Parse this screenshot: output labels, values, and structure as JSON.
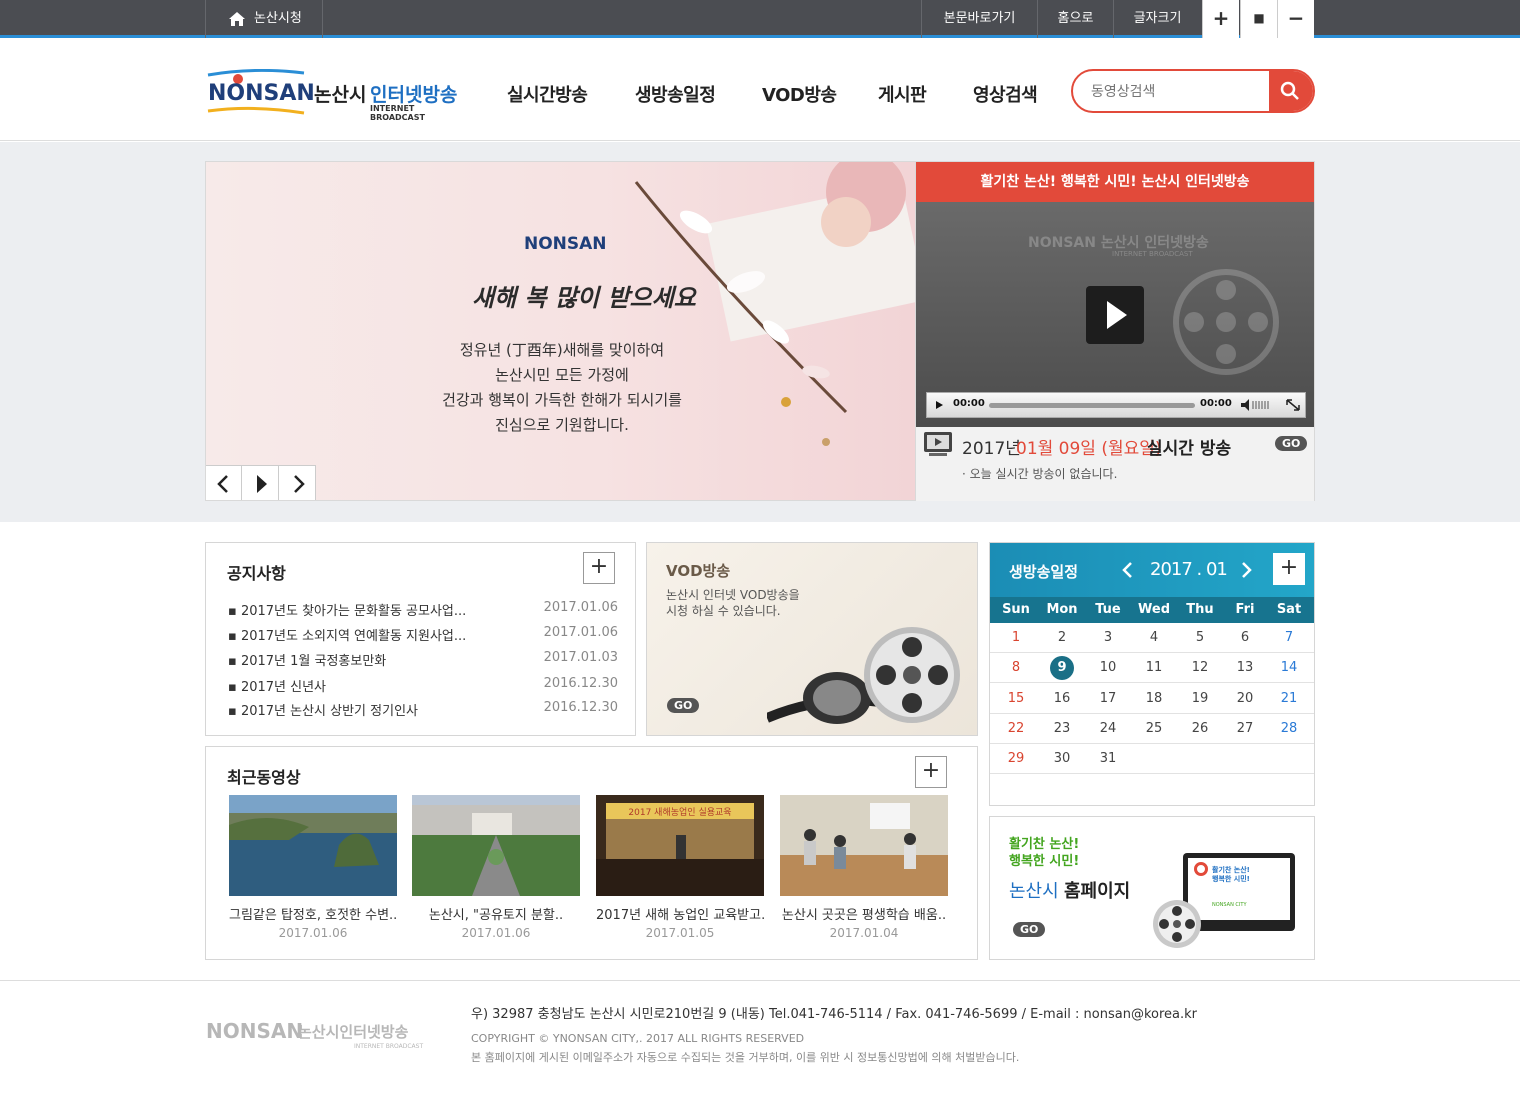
{
  "topbar": {
    "home_label": "논산시청",
    "skip_label": "본문바로가기",
    "home2_label": "홈으로",
    "fontsize_label": "글자크기",
    "fs_plus": "+",
    "fs_reset": "■",
    "fs_minus": "−"
  },
  "header": {
    "logo_en": "NONSAN",
    "logo_ko_a": "논산시",
    "logo_ko_b": "인터넷방송",
    "logo_sub": "INTERNET BROADCAST",
    "nav": [
      "실시간방송",
      "생방송일정",
      "VOD방송",
      "게시판",
      "영상검색"
    ],
    "search_placeholder": "동영상검색"
  },
  "hero": {
    "slide_logo": "NONSAN",
    "slide_heading": "새해 복 많이 받으세요",
    "slide_lines": [
      "정유년 (丁酉年)새해를 맞이하여",
      "논산시민 모든 가정에",
      "건강과 행복이 가득한 한해가 되시기를",
      "진심으로 기원합니다."
    ],
    "player_banner": "활기찬 논산! 행복한 시민! 논산시 인터넷방송",
    "player_watermark": "NONSAN 논산시 인터넷방송",
    "player_watermark_sub": "INTERNET BROADCAST",
    "time_current": "00:00",
    "time_total": "00:00",
    "live_year": "2017년",
    "live_date": "01월 09일 (월요일)",
    "live_title": "실시간 방송",
    "live_go": "GO",
    "live_note": "오늘 실시간 방송이 없습니다."
  },
  "notice": {
    "title": "공지사항",
    "items": [
      {
        "title": "2017년도 찾아가는 문화활동 공모사업...",
        "date": "2017.01.06"
      },
      {
        "title": "2017년도 소외지역 연예활동 지원사업...",
        "date": "2017.01.06"
      },
      {
        "title": "2017년 1월 국정홍보만화",
        "date": "2017.01.03"
      },
      {
        "title": " 2017년 신년사",
        "date": "2016.12.30"
      },
      {
        "title": "2017년 논산시 상반기 정기인사",
        "date": "2016.12.30"
      }
    ]
  },
  "vod": {
    "title": "VOD방송",
    "desc1": "논산시 인터넷 VOD방송을",
    "desc2": "시청 하실 수 있습니다.",
    "go": "GO"
  },
  "recent": {
    "title": "최근동영상",
    "items": [
      {
        "title": "그림같은 탑정호, 호젓한 수변..",
        "date": "2017.01.06"
      },
      {
        "title": "논산시, \"공유토지 분할..",
        "date": "2017.01.06"
      },
      {
        "title": "2017년 새해 농업인 교육받고..",
        "date": "2017.01.05"
      },
      {
        "title": "논산시 곳곳은 평생학습 배움..",
        "date": "2017.01.04"
      }
    ]
  },
  "calendar": {
    "title": "생방송일정",
    "month": "2017 . 01",
    "days": [
      "Sun",
      "Mon",
      "Tue",
      "Wed",
      "Thu",
      "Fri",
      "Sat"
    ],
    "weeks": [
      [
        "1",
        "2",
        "3",
        "4",
        "5",
        "6",
        "7"
      ],
      [
        "8",
        "9",
        "10",
        "11",
        "12",
        "13",
        "14"
      ],
      [
        "15",
        "16",
        "17",
        "18",
        "19",
        "20",
        "21"
      ],
      [
        "22",
        "23",
        "24",
        "25",
        "26",
        "27",
        "28"
      ],
      [
        "29",
        "30",
        "31",
        "",
        "",
        "",
        ""
      ]
    ],
    "today": "9",
    "colors": {
      "header": "#1e8fb5",
      "days_bar": "#17748f",
      "sun": "#d9442f",
      "sat": "#2a7ad6",
      "today": "#1a6f86"
    }
  },
  "homepage": {
    "line1": "활기찬 논산!",
    "line2": "행복한 시민!",
    "line3_a": "논산시",
    "line3_b": "홈페이지",
    "go": "GO",
    "monitor_text1": "활기찬 논산!",
    "monitor_text2": "행복한 시민!",
    "monitor_brand": "NONSAN CITY"
  },
  "footer": {
    "logo_en": "NONSAN",
    "logo_ko": "논산시인터넷방송",
    "logo_sub": "INTERNET BROADCAST",
    "address": "우) 32987 충청남도 논산시 시민로210번길 9 (내동) Tel.041-746-5114 / Fax. 041-746-5699 / E-mail : nonsan@korea.kr",
    "copyright": "COPYRIGHT © YNONSAN CITY,. 2017 ALL RIGHTS RESERVED",
    "notice": "본 홈페이지에 게시된 이메일주소가 자동으로 수집되는 것을 거부하며, 이를 위반 시 정보통신망법에 의해 처벌받습니다."
  },
  "colors": {
    "accent_red": "#e24a3a",
    "accent_blue": "#2a8ed6",
    "topbar_bg": "#4b4d52"
  }
}
